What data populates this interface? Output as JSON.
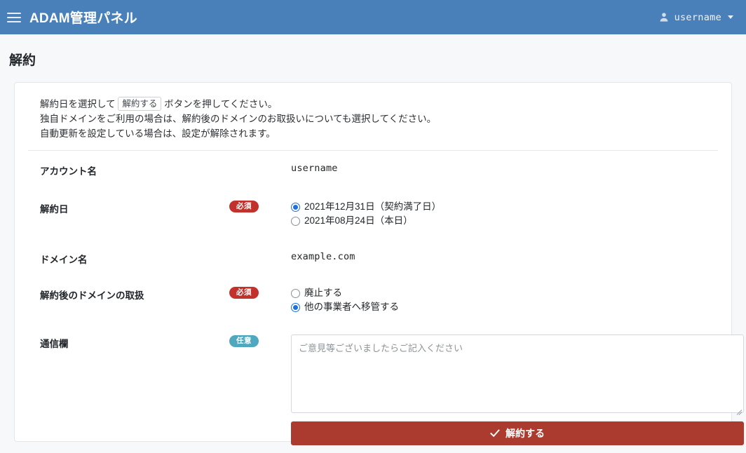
{
  "navbar": {
    "menu_icon": "hamburger-icon",
    "brand": "ADAM管理パネル",
    "user_icon": "user-icon",
    "username": "username",
    "caret_icon": "chevron-down-icon"
  },
  "page": {
    "title": "解約"
  },
  "intro": {
    "line1_before": "解約日を選択して",
    "line1_kbd": "解約する",
    "line1_after": "ボタンを押してください。",
    "line2": "独自ドメインをご利用の場合は、解約後のドメインのお取扱いについても選択してください。",
    "line3": "自動更新を設定している場合は、設定が解除されます。"
  },
  "form": {
    "account": {
      "label": "アカウント名",
      "value": "username"
    },
    "cancel_date": {
      "label": "解約日",
      "badge": "必須",
      "options": [
        {
          "label": "2021年12月31日（契約満了日）",
          "checked": true
        },
        {
          "label": "2021年08月24日（本日）",
          "checked": false
        }
      ]
    },
    "domain": {
      "label": "ドメイン名",
      "value": "example.com"
    },
    "domain_handling": {
      "label": "解約後のドメインの取扱",
      "badge": "必須",
      "options": [
        {
          "label": "廃止する",
          "checked": false
        },
        {
          "label": "他の事業者へ移管する",
          "checked": true
        }
      ]
    },
    "comment": {
      "label": "通信欄",
      "badge": "任意",
      "placeholder": "ご意見等ございましたらご記入ください",
      "value": ""
    },
    "submit": {
      "icon": "check-icon",
      "label": "解約する"
    }
  },
  "colors": {
    "navbar_bg": "#4a80ba",
    "badge_required": "#c2322c",
    "badge_optional": "#4fa8bd",
    "submit_bg": "#ab3a2f",
    "radio_accent": "#1f6fe0",
    "page_bg": "#f7f8fa"
  }
}
